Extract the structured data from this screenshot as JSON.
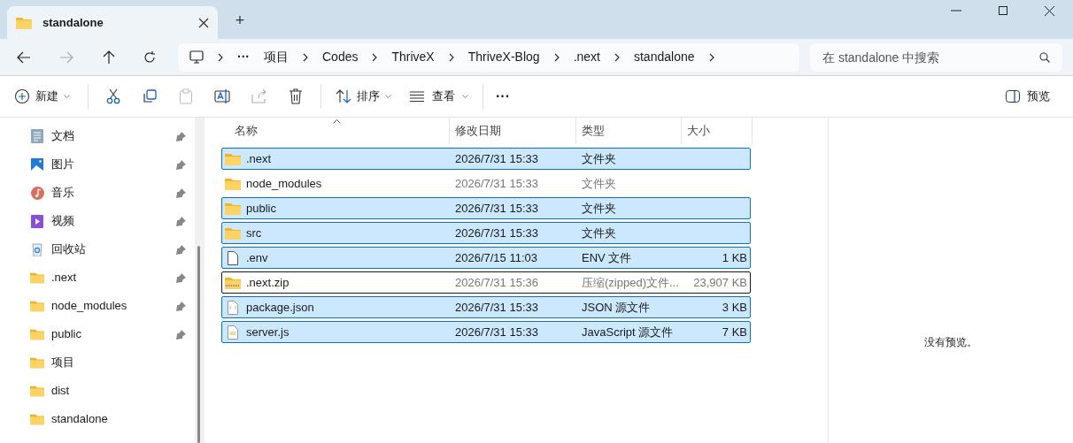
{
  "window": {
    "tab_title": "standalone",
    "new_tab": "+"
  },
  "breadcrumb": {
    "overflow": "···",
    "parts": [
      "项目",
      "Codes",
      "ThriveX",
      "ThriveX-Blog",
      ".next",
      "standalone"
    ]
  },
  "search": {
    "placeholder": "在 standalone 中搜索"
  },
  "toolbar": {
    "new": "新建",
    "sort": "排序",
    "view": "查看",
    "more": "···",
    "preview": "预览"
  },
  "sidebar": {
    "items": [
      {
        "label": "文档",
        "kind": "doc",
        "pinned": true
      },
      {
        "label": "图片",
        "kind": "picture",
        "pinned": true
      },
      {
        "label": "音乐",
        "kind": "music",
        "pinned": true
      },
      {
        "label": "视频",
        "kind": "video",
        "pinned": true
      },
      {
        "label": "回收站",
        "kind": "recycle",
        "pinned": true
      },
      {
        "label": ".next",
        "kind": "folder",
        "pinned": true
      },
      {
        "label": "node_modules",
        "kind": "folder",
        "pinned": true
      },
      {
        "label": "public",
        "kind": "folder",
        "pinned": true
      },
      {
        "label": "项目",
        "kind": "folder",
        "pinned": false
      },
      {
        "label": "dist",
        "kind": "folder",
        "pinned": false
      },
      {
        "label": "standalone",
        "kind": "folder",
        "pinned": false
      }
    ]
  },
  "table": {
    "columns": [
      "名称",
      "修改日期",
      "类型",
      "大小"
    ],
    "rows": [
      {
        "name": ".next",
        "date": "2026/7/31 15:33",
        "type": "文件夹",
        "kind": "folder",
        "selected": true,
        "focused": false
      },
      {
        "name": "node_modules",
        "date": "2026/7/31 15:33",
        "type": "文件夹",
        "kind": "folder",
        "selected": false,
        "focused": false
      },
      {
        "name": "public",
        "date": "2026/7/31 15:33",
        "type": "文件夹",
        "kind": "folder",
        "selected": true,
        "focused": false
      },
      {
        "name": "src",
        "date": "2026/7/31 15:33",
        "type": "文件夹",
        "kind": "folder",
        "selected": true,
        "focused": false
      },
      {
        "name": ".env",
        "date": "2026/7/15 11:03",
        "type": "ENV 文件",
        "size": "1 KB",
        "kind": "file",
        "selected": true,
        "focused": false
      },
      {
        "name": ".next.zip",
        "date": "2026/7/31 15:36",
        "type": "压缩(zipped)文件...",
        "size": "23,907 KB",
        "kind": "zip",
        "selected": false,
        "focused": true
      },
      {
        "name": "package.json",
        "date": "2026/7/31 15:33",
        "type": "JSON 源文件",
        "size": "3 KB",
        "kind": "json",
        "selected": true,
        "focused": false
      },
      {
        "name": "server.js",
        "date": "2026/7/31 15:33",
        "type": "JavaScript 源文件",
        "size": "7 KB",
        "kind": "js",
        "selected": true,
        "focused": false
      }
    ]
  },
  "preview_pane": {
    "message": "没有预览。"
  }
}
